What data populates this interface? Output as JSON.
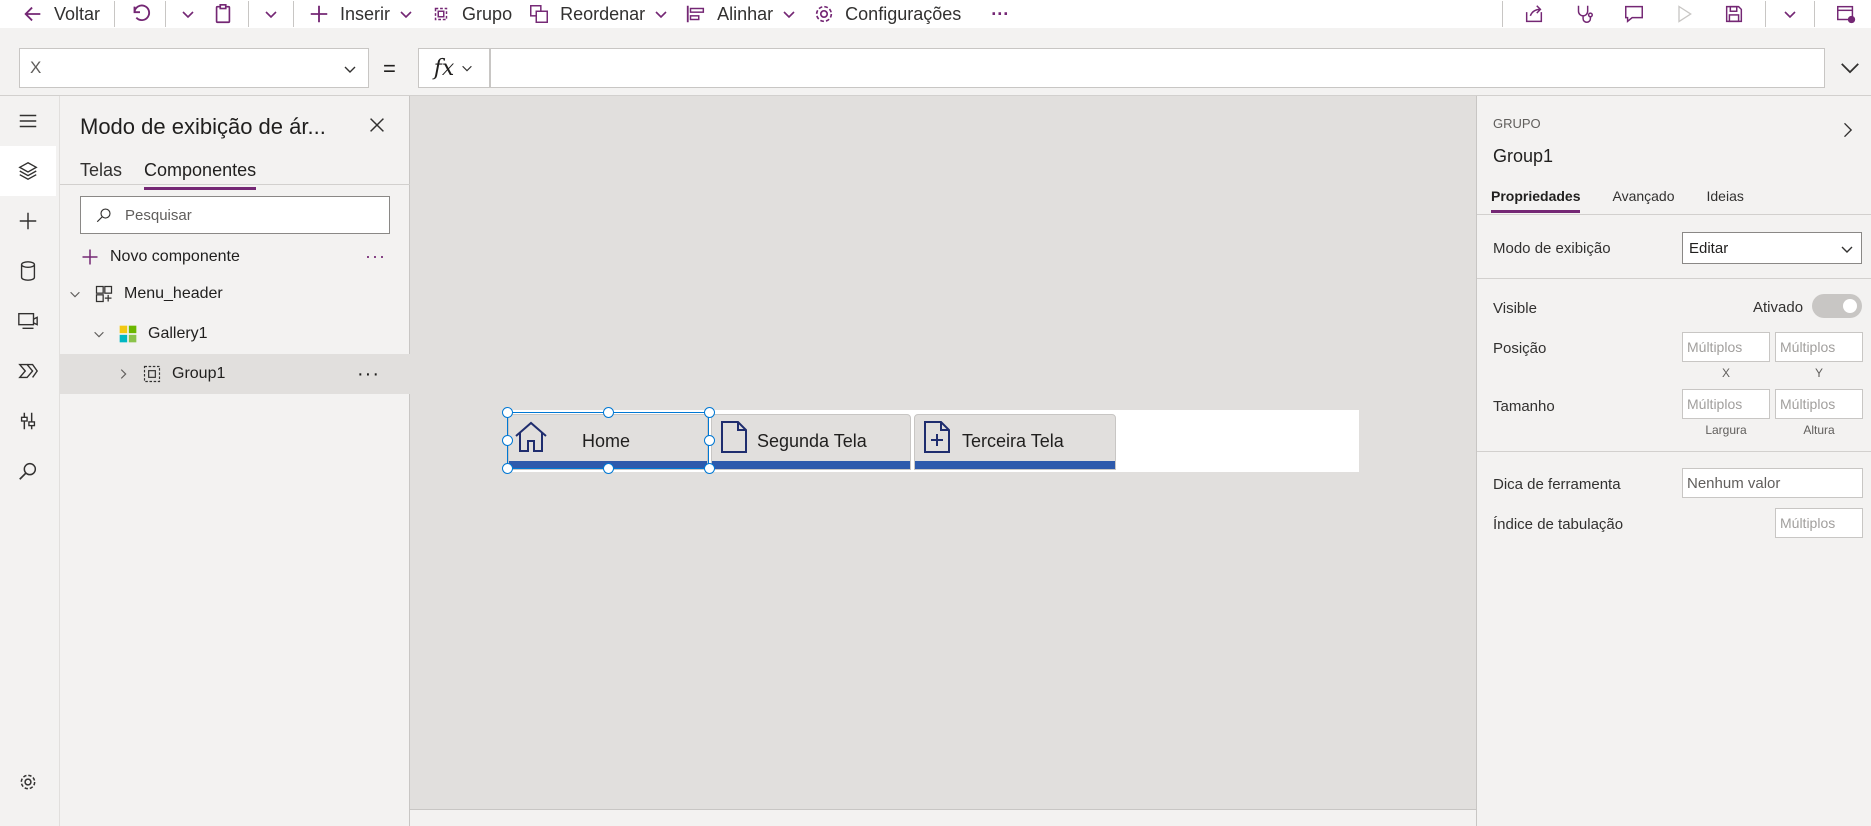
{
  "command_bar": {
    "back_label": "Voltar",
    "insert_label": "Inserir",
    "group_label": "Grupo",
    "reorder_label": "Reordenar",
    "align_label": "Alinhar",
    "settings_label": "Configurações",
    "more_label": "···"
  },
  "formula_bar": {
    "property_value": "X",
    "equals": "=",
    "fx_label": "fx",
    "formula_value": ""
  },
  "tree_view": {
    "title": "Modo de exibição de ár...",
    "tabs": [
      "Telas",
      "Componentes"
    ],
    "active_tab": "Componentes",
    "search_placeholder": "Pesquisar",
    "new_component_label": "Novo componente",
    "more_label": "···",
    "nodes": [
      {
        "label": "Menu_header",
        "icon": "component-icon"
      },
      {
        "label": "Gallery1",
        "icon": "gallery-icon"
      },
      {
        "label": "Group1",
        "icon": "group-icon",
        "selected": true
      }
    ]
  },
  "canvas": {
    "buttons": [
      {
        "label": "Home",
        "icon": "home-icon"
      },
      {
        "label": "Segunda Tela",
        "icon": "document-icon"
      },
      {
        "label": "Terceira Tela",
        "icon": "document-add-icon"
      }
    ],
    "accent_color": "#2e5aac",
    "selection_color": "#0078d4"
  },
  "properties": {
    "type_label": "GRUPO",
    "name": "Group1",
    "tabs": [
      "Propriedades",
      "Avançado",
      "Ideias"
    ],
    "active_tab": "Propriedades",
    "display_mode_label": "Modo de exibição",
    "display_mode_value": "Editar",
    "visible_label": "Visible",
    "visible_state": "Ativado",
    "position_label": "Posição",
    "size_label": "Tamanho",
    "multiple_placeholder": "Múltiplos",
    "x_caption": "X",
    "y_caption": "Y",
    "width_caption": "Largura",
    "height_caption": "Altura",
    "tooltip_label": "Dica de ferramenta",
    "tooltip_placeholder": "Nenhum valor",
    "tab_index_label": "Índice de tabulação"
  },
  "theme": {
    "brand_color": "#742774"
  }
}
